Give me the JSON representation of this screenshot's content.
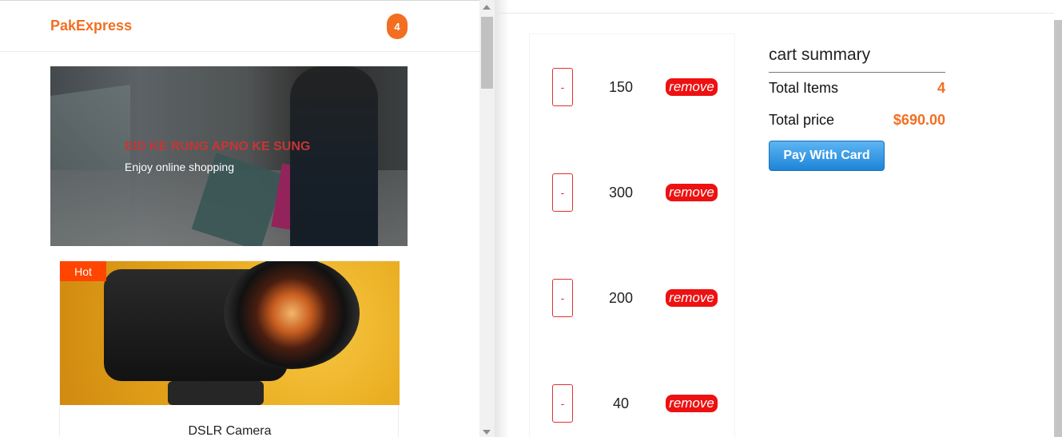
{
  "navbar": {
    "brand": "PakExpress",
    "cart_count": "4"
  },
  "hero": {
    "title": "EID KE RUNG APNO KE SUNG",
    "subtitle": "Enjoy online shopping"
  },
  "product": {
    "badge": "Hot",
    "name": "DSLR Camera"
  },
  "cart": {
    "items": [
      {
        "decrement_label": "-",
        "amount": "150",
        "remove_label": "remove"
      },
      {
        "decrement_label": "-",
        "amount": "300",
        "remove_label": "remove"
      },
      {
        "decrement_label": "-",
        "amount": "200",
        "remove_label": "remove"
      },
      {
        "decrement_label": "-",
        "amount": "40",
        "remove_label": "remove"
      }
    ]
  },
  "summary": {
    "title": "cart summary",
    "total_items_label": "Total Items",
    "total_items_value": "4",
    "total_price_label": "Total price",
    "total_price_value": "$690.00",
    "pay_button": "Pay With Card"
  },
  "colors": {
    "brand": "#f26f21",
    "remove": "#ee1111",
    "hot": "#ff4500",
    "pay": "#1e84d8"
  }
}
